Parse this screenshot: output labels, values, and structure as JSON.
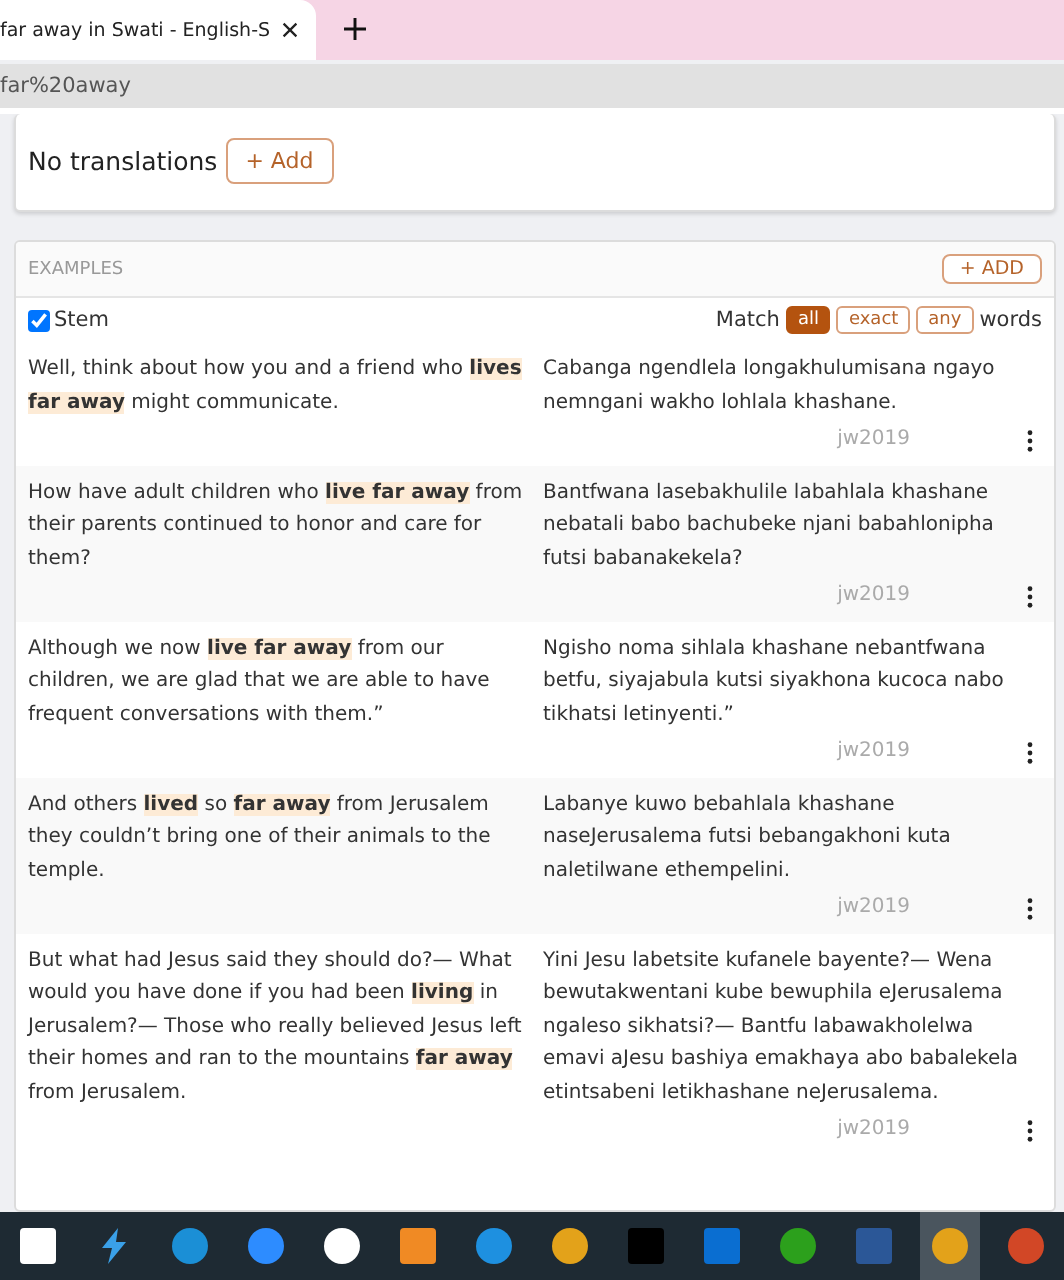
{
  "browser": {
    "tab": {
      "title": "far away in Swati - English-S",
      "selected": true
    },
    "address": "far%20away"
  },
  "translations": {
    "text": "No translations",
    "add_button": "+ Add"
  },
  "examples": {
    "title": "EXAMPLES",
    "add_button": "+ ADD",
    "stem": {
      "label": "Stem",
      "checked": true
    },
    "match": {
      "label": "Match",
      "suffix": "words",
      "options": [
        {
          "label": "all",
          "selected": true
        },
        {
          "label": "exact",
          "selected": false
        },
        {
          "label": "any",
          "selected": false
        }
      ]
    },
    "rows": [
      {
        "source": "Well, think about how you and a friend who **lives far away** might communicate.",
        "target": "Cabanga ngendlela longakhulumisana ngayo nemngani wakho lohlala khashane.",
        "origin": "jw2019"
      },
      {
        "source": "How have adult children who **live far away** from their parents continued to honor and care for them?",
        "target": "Bantfwana lasebakhulile labahlala khashane nebatali babo bachubeke njani babahlonipha futsi babanakekela?",
        "origin": "jw2019"
      },
      {
        "source": "Although we now **live far away** from our children, we are glad that we are able to have frequent conversations with them.”",
        "target": "Ngisho noma sihlala khashane nebantfwana betfu, siyajabula kutsi siyakhona kucoca nabo tikhatsi letinyenti.”",
        "origin": "jw2019"
      },
      {
        "source": "And others **lived** so **far away** from Jerusalem they couldn’t bring one of their animals to the temple.",
        "target": "Labanye kuwo bebahlala khashane naseJerusalema futsi bebangakhoni kuta naletilwane ethempelini.",
        "origin": "jw2019"
      },
      {
        "source": "But what had Jesus said they should do?— What would you have done if you had been **living** in Jerusalem?— Those who really believed Jesus left their homes and ran to the mountains **far away** from Jerusalem.",
        "target": "Yini Jesu labetsite kufanele bayente?— Wena bewutakwentani kube bewuphila eJerusalema ngaleso sikhatsi?— Bantfu labawakholelwa emavi aJesu bashiya emakhaya abo babalekela etintsabeni letikhashane neJerusalema.",
        "origin": "jw2019"
      }
    ]
  },
  "taskbar": [
    {
      "kind": "square",
      "color": "#ffffff",
      "selected": false
    },
    {
      "kind": "bolt",
      "color": "#3aa0e8",
      "selected": false
    },
    {
      "kind": "circle",
      "color": "#1b8fd6",
      "selected": false
    },
    {
      "kind": "circle",
      "color": "#2d8cff",
      "selected": false
    },
    {
      "kind": "circle",
      "color": "#ffffff",
      "selected": false
    },
    {
      "kind": "square",
      "color": "#f08a24",
      "selected": false
    },
    {
      "kind": "circle",
      "color": "#1e90e0",
      "selected": false
    },
    {
      "kind": "circle",
      "color": "#e3a21a",
      "selected": false
    },
    {
      "kind": "square",
      "color": "#000000",
      "selected": false
    },
    {
      "kind": "square",
      "color": "#0a6ed1",
      "selected": false
    },
    {
      "kind": "circle",
      "color": "#2ca01c",
      "selected": false
    },
    {
      "kind": "square",
      "color": "#2b5797",
      "selected": false
    },
    {
      "kind": "circle",
      "color": "#e3a21a",
      "selected": true
    },
    {
      "kind": "circle",
      "color": "#d24726",
      "selected": false
    }
  ]
}
